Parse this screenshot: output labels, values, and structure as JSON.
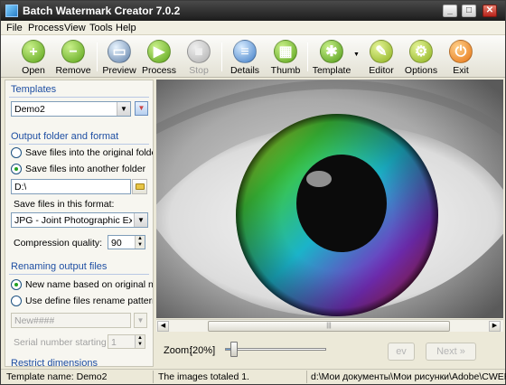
{
  "app": {
    "title": "Batch Watermark Creator 7.0.2"
  },
  "menu": [
    "File",
    "Process",
    "View",
    "Tools",
    "Help"
  ],
  "toolbar": {
    "open": "Open",
    "remove": "Remove",
    "preview": "Preview",
    "process": "Process",
    "stop": "Stop",
    "details": "Details",
    "thumb": "Thumb",
    "template": "Template",
    "editor": "Editor",
    "options": "Options",
    "exit": "Exit"
  },
  "templates": {
    "header": "Templates",
    "selected": "Demo2"
  },
  "output": {
    "header": "Output folder and format",
    "radio_original": "Save files into the original folder",
    "radio_another": "Save files into another folder",
    "selected_radio": "another",
    "folder_value": "D:\\",
    "format_label": "Save files in this format:",
    "format_value": "JPG - Joint Photographic Experts G",
    "quality_label": "Compression quality:",
    "quality_value": "90"
  },
  "renaming": {
    "header": "Renaming output files",
    "radio_original_name": "New name based on original name",
    "radio_pattern": "Use define files rename pattern",
    "selected_radio": "original_name",
    "pattern_value": "New####",
    "serial_label": "Serial number starting with",
    "serial_value": "1"
  },
  "restrict": {
    "header": "Restrict dimensions"
  },
  "zoom": {
    "label": "Zoom:",
    "value": "[20%]",
    "level_percent": 20
  },
  "nav": {
    "prev": "ev",
    "next": "Next"
  },
  "status": {
    "template_name": "Template name: Demo2",
    "images_total": "The images totaled 1.",
    "path": "d:\\Мои документы\\Мои рисунки\\Adobe\\CWER.ru"
  },
  "colors": {
    "section_header": "#1f4fa3",
    "title_bar": "#1c1c1c"
  }
}
